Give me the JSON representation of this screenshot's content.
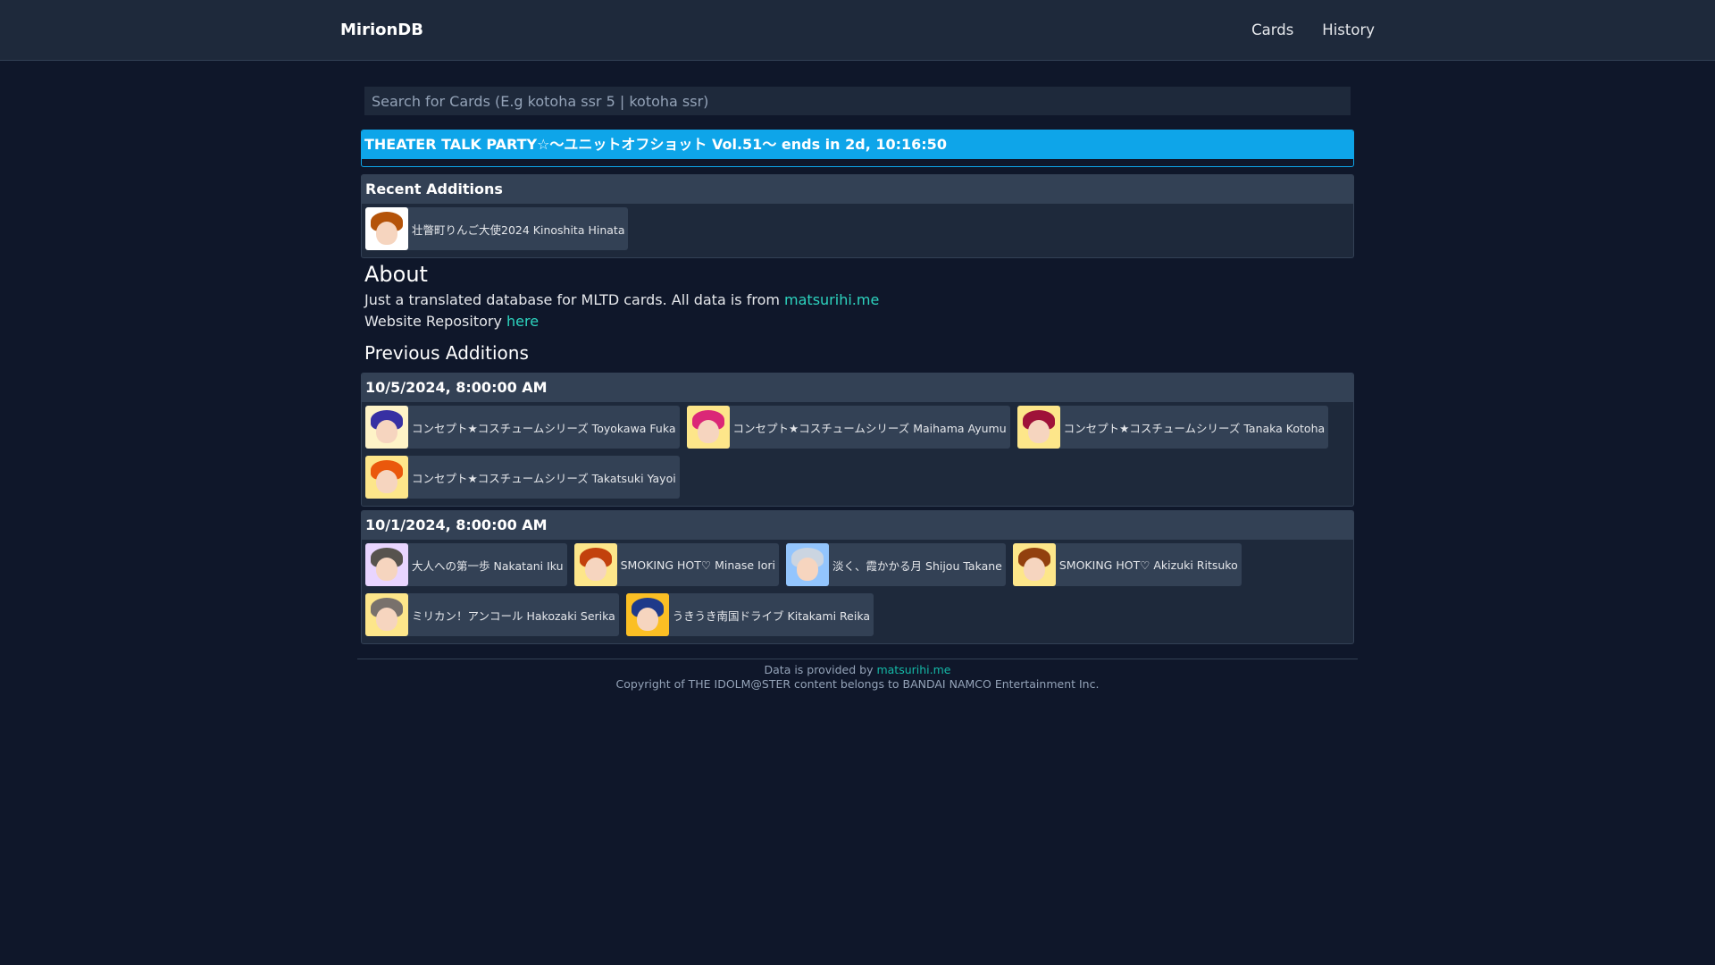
{
  "nav": {
    "brand": "MirionDB",
    "links": [
      "Cards",
      "History"
    ]
  },
  "search": {
    "placeholder": "Search for Cards (E.g kotoha ssr 5 | kotoha ssr)"
  },
  "event": {
    "text": "THEATER TALK PARTY☆～ユニットオフショット Vol.51～ ends in 2d, 10:16:50"
  },
  "recent": {
    "title": "Recent Additions",
    "cards": [
      {
        "label": "壮瞥町りんご大使2024 Kinoshita Hinata"
      }
    ]
  },
  "about": {
    "title": "About",
    "line1_text": "Just a translated database for MLTD cards. All data is from ",
    "line1_link": "matsurihi.me",
    "line2_text": "Website Repository ",
    "line2_link": "here"
  },
  "previous": {
    "title": "Previous Additions",
    "groups": [
      {
        "date": "10/5/2024, 8:00:00 AM",
        "cards": [
          {
            "label": "コンセプト★コスチュームシリーズ Toyokawa Fuka"
          },
          {
            "label": "コンセプト★コスチュームシリーズ Maihama Ayumu"
          },
          {
            "label": "コンセプト★コスチュームシリーズ Tanaka Kotoha"
          },
          {
            "label": "コンセプト★コスチュームシリーズ Takatsuki Yayoi"
          }
        ]
      },
      {
        "date": "10/1/2024, 8:00:00 AM",
        "cards": [
          {
            "label": "大人への第一歩 Nakatani Iku"
          },
          {
            "label": "SMOKING HOT♡ Minase Iori"
          },
          {
            "label": "淡く、霞かかる月 Shijou Takane"
          },
          {
            "label": "SMOKING HOT♡ Akizuki Ritsuko"
          },
          {
            "label": "ミリカン！アンコール Hakozaki Serika"
          },
          {
            "label": "うきうき南国ドライブ Kitakami Reika"
          }
        ]
      }
    ]
  },
  "footer": {
    "line1_text": "Data is provided by ",
    "line1_link": "matsurihi.me",
    "line2": "Copyright of THE IDOLM@STER content belongs to BANDAI NAMCO Entertainment Inc."
  },
  "colors": {
    "background": "#0f172a",
    "navbar": "#1e293b",
    "accent_event": "#0ea5e9",
    "link": "#2dd4bf"
  }
}
